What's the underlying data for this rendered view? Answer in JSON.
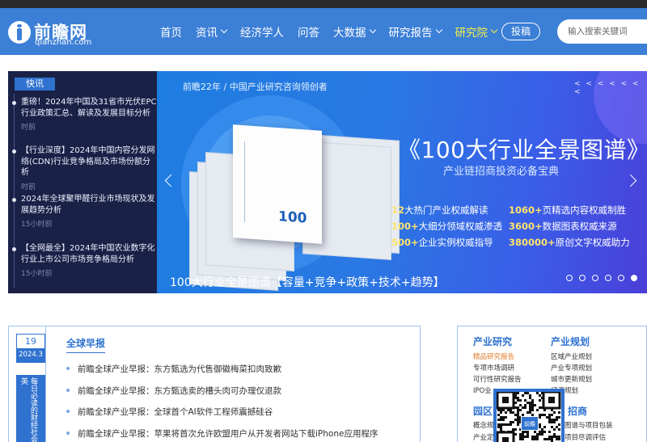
{
  "header": {
    "logo_cn": "前瞻网",
    "logo_en": "qianzhan.com",
    "nav": [
      {
        "label": "首页",
        "dropdown": false,
        "active": false
      },
      {
        "label": "资讯",
        "dropdown": true,
        "active": false
      },
      {
        "label": "经济学人",
        "dropdown": false,
        "active": false
      },
      {
        "label": "问答",
        "dropdown": false,
        "active": false
      },
      {
        "label": "大数据",
        "dropdown": true,
        "active": false
      },
      {
        "label": "研究报告",
        "dropdown": true,
        "active": false
      },
      {
        "label": "研究院",
        "dropdown": true,
        "active": true
      }
    ],
    "tougao_label": "投稿",
    "search_placeholder": "输入搜索关键词",
    "colors": {
      "bar": "#3c7fd6",
      "active": "#f3f04a"
    }
  },
  "kuaixun": {
    "title": "快讯",
    "items": [
      {
        "text": "重磅！2024年中国及31省市光伏EPC行业政策汇总、解读及发展目标分析",
        "time": "时前"
      },
      {
        "text": "【行业深度】2024年中国内容分发网络(CDN)行业竞争格局及市场份额分析",
        "time": "时前"
      },
      {
        "text": "2024年全球聚甲醛行业市场现状及发展趋势分析",
        "time": "15小时前"
      },
      {
        "text": "【全网最全】2024年中国农业数字化行业上市公司市场竞争格局分析",
        "time": "15小时前"
      }
    ]
  },
  "banner": {
    "top_line": "前瞻22年 / 中国产业研究咨询领创者",
    "arrows": "< < < < < < <",
    "headline": "《100大行业全景图谱》",
    "subline": "产业链招商投资必备宝典",
    "book_title": "100",
    "features": [
      {
        "num": "12",
        "text": "大热门产业权威解读"
      },
      {
        "num": "1060+",
        "text": "页精选内容权威制胜"
      },
      {
        "num": "100+",
        "text": "大细分领域权威渗透"
      },
      {
        "num": "3600+",
        "text": "数据图表权威来源"
      },
      {
        "num": "500+",
        "text": "企业实例权威指导"
      },
      {
        "num": "380000+",
        "text": "原创文字权威助力"
      }
    ],
    "caption": "100大行业全景图谱【容量+竞争+政策+技术+趋势】",
    "dot_count": 6,
    "active_dot": 5
  },
  "zaobao": {
    "date_day": "19",
    "date_ym": "2024.3",
    "vertical_text": "每日必读的财经社会精英",
    "title": "全球早报",
    "items": [
      "前瞻全球产业早报：东方甄选为代售御徽梅菜扣肉致歉",
      "前瞻全球产业早报：东方甄选卖的槽头肉可办理仅退款",
      "前瞻全球产业早报：全球首个AI软件工程师震撼硅谷",
      "前瞻全球产业早报：苹果将首次允许欧盟用户从开发者网站下载iPhone应用程序"
    ]
  },
  "right_panel": {
    "col1_head": "产业研究",
    "col1_links": [
      {
        "text": "精品研究报告",
        "hot": true
      },
      {
        "text": "专项市场调研",
        "hot": false
      },
      {
        "text": "可行性研究报告",
        "hot": false
      },
      {
        "text": "IPO业",
        "hot": false
      }
    ],
    "col2_head": "产业规划",
    "col2_links": [
      "区域产业规划",
      "产业专项规划",
      "城市更新规划",
      "经济规划"
    ],
    "col1_head2": "园区",
    "col1_links2": [
      "概念规",
      "产业定"
    ],
    "col2_head2": "招商",
    "col2_links2": [
      "图谱与项目包装",
      "项目尽调评估"
    ],
    "qr_label": "前瞻"
  }
}
